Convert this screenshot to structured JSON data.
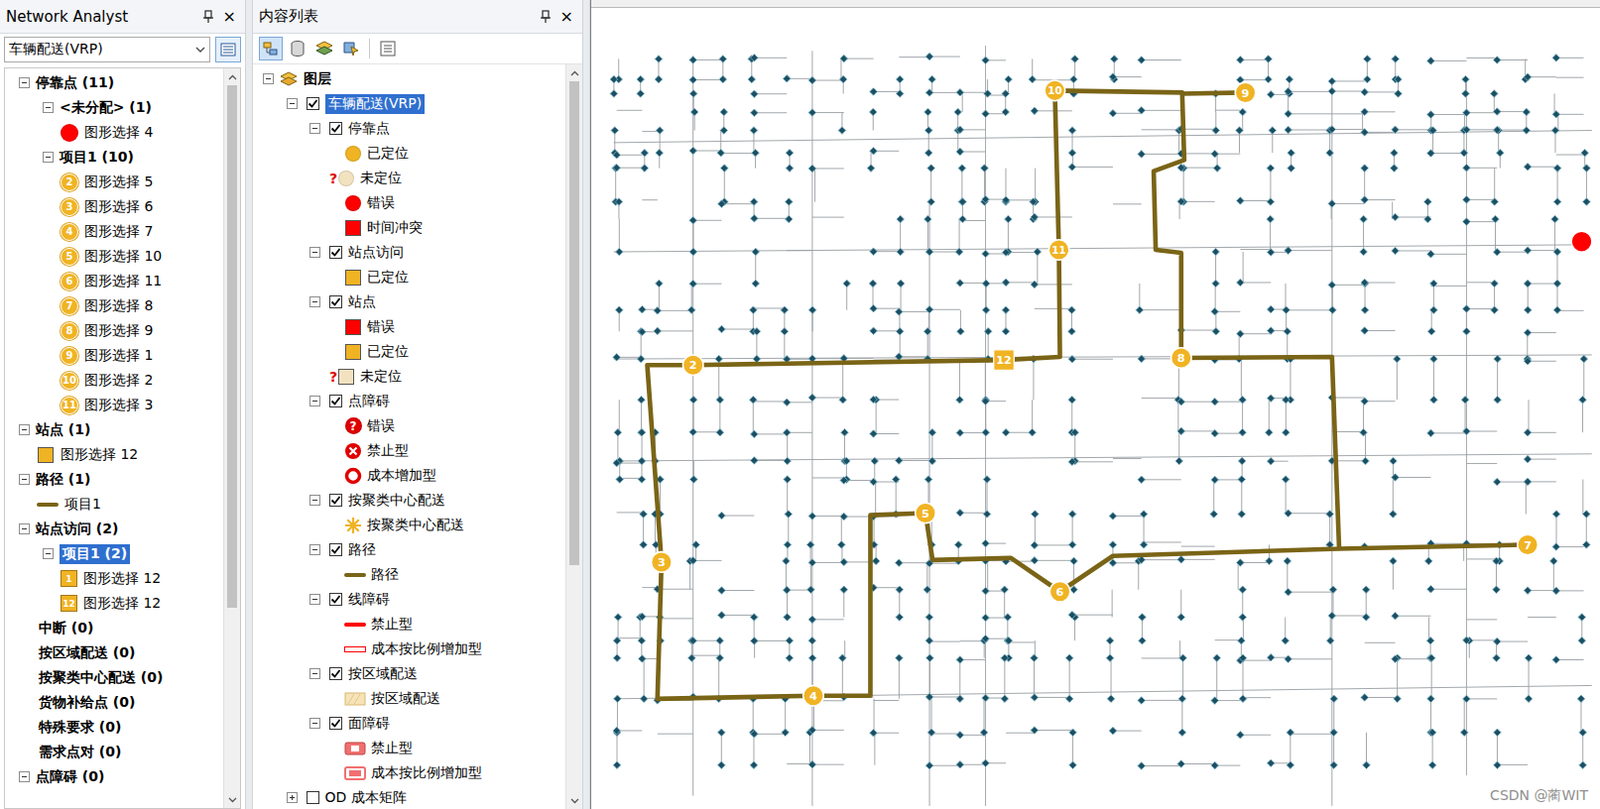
{
  "network_analyst": {
    "title": "Network Analyst",
    "close": "×",
    "dropdown": {
      "value": "车辆配送(VRP)"
    },
    "scrollbar": {
      "level": 0.74
    },
    "tree": [
      {
        "kind": "group",
        "label": "停靠点 (11)",
        "expanded": true,
        "selected": false,
        "children": [
          {
            "kind": "group",
            "label": "<未分配> (1)",
            "expanded": true,
            "selected": false,
            "children": [
              {
                "kind": "item",
                "symbol": "dot",
                "color": "#ff0000",
                "label": "图形选择 4",
                "selected": false
              }
            ]
          },
          {
            "kind": "group",
            "label": "项目1 (10)",
            "expanded": true,
            "selected": false,
            "children": [
              {
                "kind": "item",
                "symbol": "badge-circle",
                "badge": "2",
                "label": "图形选择 5",
                "selected": false
              },
              {
                "kind": "item",
                "symbol": "badge-circle",
                "badge": "3",
                "label": "图形选择 6",
                "selected": false
              },
              {
                "kind": "item",
                "symbol": "badge-circle",
                "badge": "4",
                "label": "图形选择 7",
                "selected": false
              },
              {
                "kind": "item",
                "symbol": "badge-circle",
                "badge": "5",
                "label": "图形选择 10",
                "selected": false
              },
              {
                "kind": "item",
                "symbol": "badge-circle",
                "badge": "6",
                "label": "图形选择 11",
                "selected": false
              },
              {
                "kind": "item",
                "symbol": "badge-circle",
                "badge": "7",
                "label": "图形选择 8",
                "selected": false
              },
              {
                "kind": "item",
                "symbol": "badge-circle",
                "badge": "8",
                "label": "图形选择 9",
                "selected": false
              },
              {
                "kind": "item",
                "symbol": "badge-circle",
                "badge": "9",
                "label": "图形选择 1",
                "selected": false
              },
              {
                "kind": "item",
                "symbol": "badge-circle",
                "badge": "10",
                "label": "图形选择 2",
                "selected": false
              },
              {
                "kind": "item",
                "symbol": "badge-circle",
                "badge": "11",
                "label": "图形选择 3",
                "selected": false
              }
            ]
          }
        ]
      },
      {
        "kind": "group",
        "label": "站点 (1)",
        "expanded": true,
        "selected": false,
        "children": [
          {
            "kind": "item",
            "symbol": "square",
            "color": "#f0b323",
            "label": "图形选择 12",
            "selected": false
          }
        ]
      },
      {
        "kind": "group",
        "label": "路径 (1)",
        "expanded": true,
        "selected": false,
        "children": [
          {
            "kind": "item",
            "symbol": "line",
            "color": "#7a6416",
            "label": "项目1",
            "selected": false
          }
        ]
      },
      {
        "kind": "group",
        "label": "站点访问 (2)",
        "expanded": true,
        "selected": false,
        "children": [
          {
            "kind": "group",
            "label": "项目1 (2)",
            "expanded": true,
            "selected": true,
            "children": [
              {
                "kind": "item",
                "symbol": "badge-square",
                "badge": "1",
                "label": "图形选择 12",
                "selected": false
              },
              {
                "kind": "item",
                "symbol": "badge-square",
                "badge": "12",
                "label": "图形选择 12",
                "selected": false
              }
            ]
          }
        ]
      },
      {
        "kind": "plain",
        "label": "中断 (0)",
        "selected": false
      },
      {
        "kind": "plain",
        "label": "按区域配送 (0)",
        "selected": false
      },
      {
        "kind": "plain",
        "label": "按聚类中心配送 (0)",
        "selected": false
      },
      {
        "kind": "plain",
        "label": "货物补给点 (0)",
        "selected": false
      },
      {
        "kind": "plain",
        "label": "特殊要求 (0)",
        "selected": false
      },
      {
        "kind": "plain",
        "label": "需求点对 (0)",
        "selected": false
      },
      {
        "kind": "group",
        "label": "点障碍 (0)",
        "expanded": true,
        "selected": false,
        "children": []
      }
    ]
  },
  "toc": {
    "title": "内容列表",
    "close": "×",
    "scrollbar": {
      "level": 0.68
    },
    "toolbar": [
      {
        "kind": "drawing-order",
        "selected": true
      },
      {
        "kind": "source",
        "selected": false
      },
      {
        "kind": "visibility",
        "selected": false
      },
      {
        "kind": "selection",
        "selected": false
      },
      {
        "kind": "options",
        "selected": false
      }
    ],
    "tree": [
      {
        "kind": "root",
        "label": "图层",
        "expanded": true,
        "children": [
          {
            "kind": "layer",
            "label": "车辆配送(VRP)",
            "expanded": true,
            "checked": true,
            "selected": true,
            "children": [
              {
                "kind": "layer",
                "label": "停靠点",
                "expanded": true,
                "checked": true,
                "selected": false,
                "children": [
                  {
                    "kind": "legend",
                    "symbol": "circle",
                    "color": "#f0b323",
                    "label": "已定位"
                  },
                  {
                    "kind": "legend",
                    "symbol": "circle",
                    "color": "#f3e2c0",
                    "prefix": "?",
                    "label": "未定位"
                  },
                  {
                    "kind": "legend",
                    "symbol": "circle",
                    "color": "#ff0000",
                    "label": "错误"
                  },
                  {
                    "kind": "legend",
                    "symbol": "square",
                    "color": "#ff0000",
                    "label": "时间冲突"
                  }
                ]
              },
              {
                "kind": "layer",
                "label": "站点访问",
                "expanded": true,
                "checked": true,
                "selected": false,
                "children": [
                  {
                    "kind": "legend",
                    "symbol": "square",
                    "color": "#f0b323",
                    "label": "已定位"
                  }
                ]
              },
              {
                "kind": "layer",
                "label": "站点",
                "expanded": true,
                "checked": true,
                "selected": false,
                "children": [
                  {
                    "kind": "legend",
                    "symbol": "square",
                    "color": "#ff0000",
                    "label": "错误"
                  },
                  {
                    "kind": "legend",
                    "symbol": "square",
                    "color": "#f0b323",
                    "label": "已定位"
                  },
                  {
                    "kind": "legend",
                    "symbol": "square",
                    "color": "#f3e2c0",
                    "prefix": "?",
                    "label": "未定位"
                  }
                ]
              },
              {
                "kind": "layer",
                "label": "点障碍",
                "expanded": true,
                "checked": true,
                "selected": false,
                "children": [
                  {
                    "kind": "legend",
                    "symbol": "barrier-error",
                    "color": "#e00000",
                    "glyph": "?",
                    "label": "错误"
                  },
                  {
                    "kind": "legend",
                    "symbol": "barrier-x",
                    "color": "#e00000",
                    "label": "禁止型"
                  },
                  {
                    "kind": "legend",
                    "symbol": "ring",
                    "color": "#e00000",
                    "label": "成本增加型"
                  }
                ]
              },
              {
                "kind": "layer",
                "label": "按聚类中心配送",
                "expanded": true,
                "checked": true,
                "selected": false,
                "children": [
                  {
                    "kind": "legend",
                    "symbol": "star",
                    "color": "#f0b323",
                    "label": "按聚类中心配送"
                  }
                ]
              },
              {
                "kind": "layer",
                "label": "路径",
                "expanded": true,
                "checked": true,
                "selected": false,
                "children": [
                  {
                    "kind": "legend",
                    "symbol": "line",
                    "color": "#7a6416",
                    "label": "路径"
                  }
                ]
              },
              {
                "kind": "layer",
                "label": "线障碍",
                "expanded": true,
                "checked": true,
                "selected": false,
                "children": [
                  {
                    "kind": "legend",
                    "symbol": "line",
                    "color": "#ff0000",
                    "label": "禁止型"
                  },
                  {
                    "kind": "legend",
                    "symbol": "line-hollow",
                    "color": "#ff0000",
                    "label": "成本按比例增加型"
                  }
                ]
              },
              {
                "kind": "layer",
                "label": "按区域配送",
                "expanded": true,
                "checked": true,
                "selected": false,
                "children": [
                  {
                    "kind": "legend",
                    "symbol": "area",
                    "color": "#f6e4b8",
                    "label": "按区域配送"
                  }
                ]
              },
              {
                "kind": "layer",
                "label": "面障碍",
                "expanded": true,
                "checked": true,
                "selected": false,
                "children": [
                  {
                    "kind": "legend",
                    "symbol": "polygon-x",
                    "color": "#f07070",
                    "label": "禁止型"
                  },
                  {
                    "kind": "legend",
                    "symbol": "polygon-cost",
                    "color": "#f07070",
                    "label": "成本按比例增加型"
                  }
                ]
              }
            ]
          },
          {
            "kind": "layer",
            "label": "OD 成本矩阵",
            "expanded": false,
            "checked": false,
            "selected": false,
            "children": []
          }
        ]
      }
    ]
  },
  "map": {
    "stops": [
      {
        "label": "2"
      },
      {
        "label": "3"
      },
      {
        "label": "4"
      },
      {
        "label": "5"
      },
      {
        "label": "6"
      },
      {
        "label": "7"
      },
      {
        "label": "8"
      },
      {
        "label": "9"
      },
      {
        "label": "10"
      },
      {
        "label": "11"
      }
    ],
    "depot": {
      "label": "12"
    },
    "unassigned": {
      "color": "#ff0000"
    },
    "watermark": "CSDN @蔺WIT"
  }
}
